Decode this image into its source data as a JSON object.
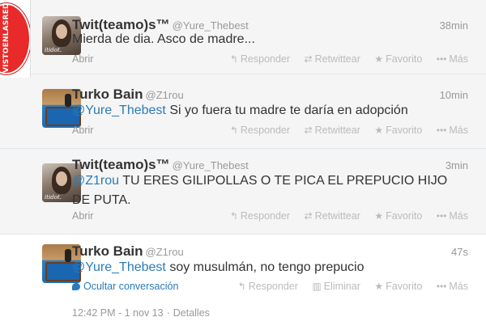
{
  "watermark": {
    "text": "VISTOENLASREDES"
  },
  "tweets": [
    {
      "fullname": "Twit(teamo)s™",
      "username": "@Yure_Thebest",
      "time": "38min",
      "mention": "",
      "text": "Mierda de dia. Asco de madre...",
      "avatar_caption": "itidot.",
      "expand": "Abrir",
      "actions": [
        "Responder",
        "Retwittear",
        "Favorito",
        "Más"
      ]
    },
    {
      "fullname": "Turko Bain",
      "username": "@Z1rou",
      "time": "10min",
      "mention": "@Yure_Thebest",
      "text": " Si yo fuera tu madre te daría en adopción",
      "avatar_caption": "",
      "expand": "Abrir",
      "actions": [
        "Responder",
        "Retwittear",
        "Favorito",
        "Más"
      ]
    },
    {
      "fullname": "Twit(teamo)s™",
      "username": "@Yure_Thebest",
      "time": "3min",
      "mention": "@Z1rou",
      "text": " TU ERES GILIPOLLAS O TE PICA EL PREPUCIO HIJO DE PUTA.",
      "avatar_caption": "itidot.",
      "expand": "Abrir",
      "actions": [
        "Responder",
        "Retwittear",
        "Favorito",
        "Más"
      ]
    },
    {
      "fullname": "Turko Bain",
      "username": "@Z1rou",
      "time": "47s",
      "mention": "@Yure_Thebest",
      "text": " soy musulmán, no tengo prepucio",
      "avatar_caption": "",
      "expand": "Ocultar conversación",
      "actions": [
        "Responder",
        "Eliminar",
        "Favorito",
        "Más"
      ]
    }
  ],
  "footer": {
    "time": "12:42 PM - 1 nov 13",
    "details": "Detalles"
  },
  "icons": {
    "reply": "reply-icon",
    "retweet": "retweet-icon",
    "delete": "trash-icon",
    "favorite": "star-icon",
    "more": "more-icon",
    "conversation": "conversation-icon"
  },
  "colors": {
    "link": "#2b7bb9",
    "watermark": "#e82a2a"
  }
}
